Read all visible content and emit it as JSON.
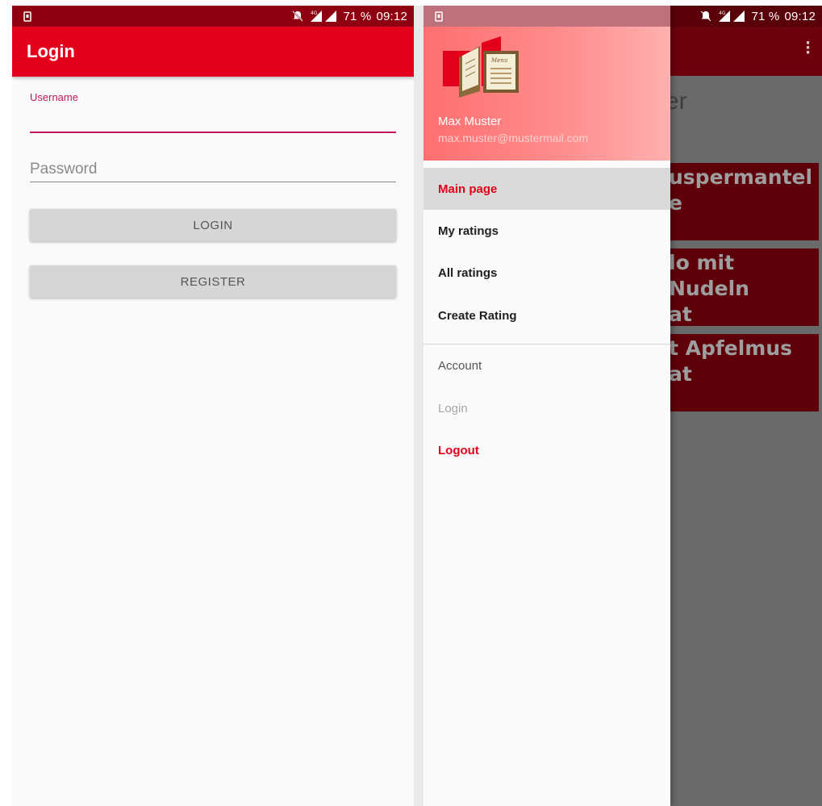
{
  "status_bar": {
    "battery_percent": "71 %",
    "time": "09:12",
    "network": "4G"
  },
  "login_screen": {
    "title": "Login",
    "username_label": "Username",
    "password_placeholder": "Password",
    "login_button": "LOGIN",
    "register_button": "REGISTER"
  },
  "drawer_screen": {
    "user_name": "Max Muster",
    "user_email": "max.muster@mustermail.com",
    "menu_items": [
      {
        "label": "Main page",
        "active": true
      },
      {
        "label": "My ratings"
      },
      {
        "label": "All ratings"
      },
      {
        "label": "Create Rating"
      }
    ],
    "account_section": {
      "header": "Account",
      "items": [
        {
          "label": "Login",
          "disabled": true
        },
        {
          "label": "Logout"
        }
      ]
    },
    "background_page": {
      "heading_fragment": "er",
      "cards": [
        {
          "line1": "uspermantel",
          "line2": "e"
        },
        {
          "line1": "lo mit Nudeln",
          "line2": "at"
        },
        {
          "line1": "t Apfelmus",
          "line2": "at"
        }
      ]
    }
  },
  "colors": {
    "primary": "#e2001a",
    "primary_dark": "#8e0011",
    "accent": "#c2185b",
    "drawer_header": "#ff8080"
  }
}
